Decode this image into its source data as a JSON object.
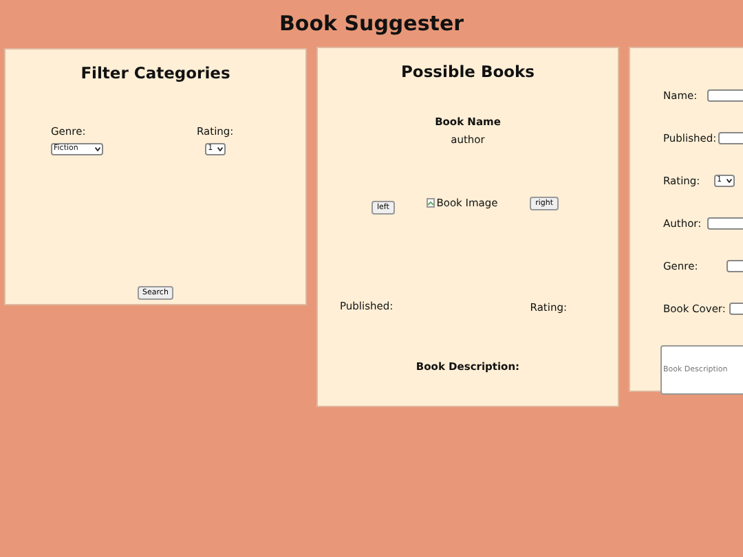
{
  "title": "Book Suggester",
  "filter": {
    "heading": "Filter Categories",
    "genre": {
      "label": "Genre:",
      "value": "Fiction"
    },
    "rating": {
      "label": "Rating:",
      "value": "1"
    },
    "button": "Search"
  },
  "books": {
    "heading": "Possible Books",
    "name": "Book Name",
    "author": "author",
    "left_button": "left",
    "image_alt": "Book Image",
    "right_button": "right",
    "published_label": "Published:",
    "rating_label": "Rating:",
    "description_label": "Book Description:"
  },
  "form": {
    "fields": [
      {
        "label": "Name:",
        "kind": "text"
      },
      {
        "label": "Published:",
        "kind": "text"
      },
      {
        "label": "Rating:",
        "kind": "select",
        "value": "1"
      },
      {
        "label": "Author:",
        "kind": "text"
      },
      {
        "label": "Genre:",
        "kind": "text"
      },
      {
        "label": "Book Cover:",
        "kind": "text"
      }
    ],
    "description_placeholder": "Book Description"
  }
}
